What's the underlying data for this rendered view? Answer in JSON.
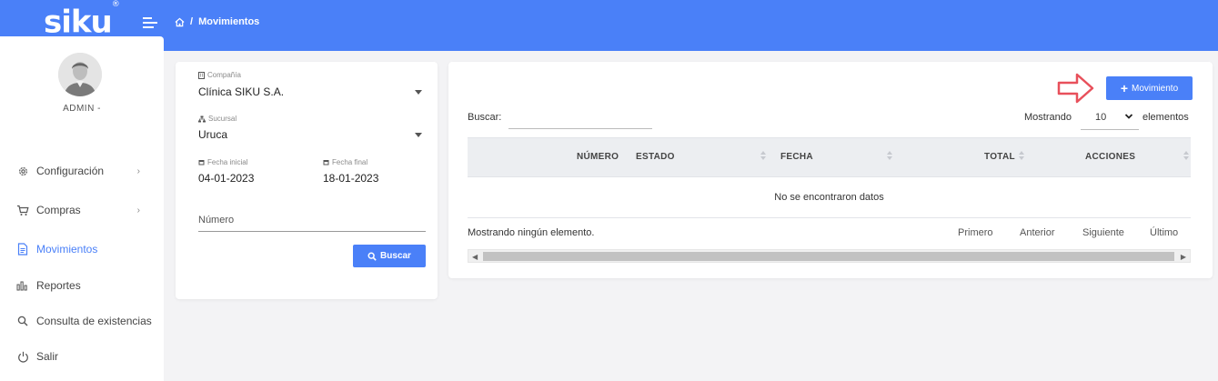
{
  "app": {
    "logo": "siku",
    "logo_mark": "®"
  },
  "breadcrumb": {
    "separator": "/",
    "current": "Movimientos"
  },
  "user": {
    "name": "ADMIN -"
  },
  "sidebar": {
    "items": [
      {
        "label": "Configuración",
        "icon": "gear-icon",
        "has_children": true
      },
      {
        "label": "Compras",
        "icon": "cart-icon",
        "has_children": true
      },
      {
        "label": "Movimientos",
        "icon": "document-icon",
        "active": true
      },
      {
        "label": "Reportes",
        "icon": "bar-chart-icon"
      },
      {
        "label": "Consulta de existencias",
        "icon": "search-icon"
      },
      {
        "label": "Salir",
        "icon": "power-icon"
      }
    ]
  },
  "filters": {
    "company_label": "Compañía",
    "company_value": "Clínica SIKU S.A.",
    "branch_label": "Sucursal",
    "branch_value": "Uruca",
    "start_date_label": "Fecha inicial",
    "start_date_value": "04-01-2023",
    "end_date_label": "Fecha final",
    "end_date_value": "18-01-2023",
    "number_placeholder": "Número",
    "search_button": "Buscar"
  },
  "table": {
    "new_button": "Movimiento",
    "search_label": "Buscar:",
    "showing_label": "Mostrando",
    "page_size": "10",
    "page_size_suffix": "elementos",
    "columns": [
      "NÚMERO",
      "ESTADO",
      "FECHA",
      "TOTAL",
      "ACCIONES"
    ],
    "empty_message": "No se encontraron datos",
    "info": "Mostrando ningún elemento.",
    "pagination": {
      "first": "Primero",
      "previous": "Anterior",
      "next": "Siguiente",
      "last": "Último"
    }
  },
  "colors": {
    "primary": "#4a80f8",
    "annotation_arrow": "#e8505b"
  }
}
